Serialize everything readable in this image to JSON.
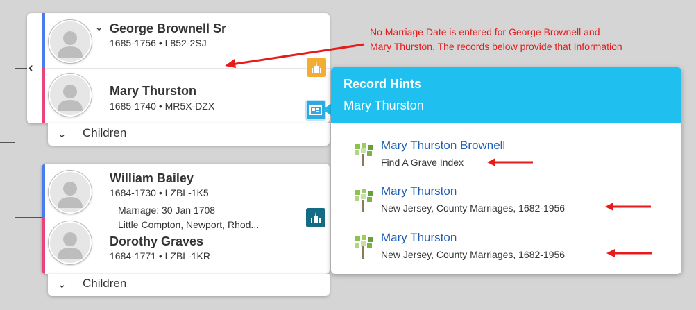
{
  "families": [
    {
      "father": {
        "name": "George Brownell Sr",
        "meta": "1685-1756 • L852-2SJ"
      },
      "mother": {
        "name": "Mary Thurston",
        "meta": "1685-1740 • MR5X-DZX"
      },
      "children_label": "Children"
    },
    {
      "father": {
        "name": "William Bailey",
        "meta": "1684-1730 • LZBL-1K5"
      },
      "marriage": {
        "date": "Marriage: 30 Jan 1708",
        "place": "Little Compton, Newport, Rhod..."
      },
      "mother": {
        "name": "Dorothy Graves",
        "meta": "1684-1771 • LZBL-1KR"
      },
      "children_label": "Children"
    }
  ],
  "annotation": {
    "line1": "No Marriage Date is entered for George Brownell and",
    "line2": "Mary Thurston. The records below provide that Information"
  },
  "record_hints": {
    "title": "Record Hints",
    "person": "Mary Thurston",
    "items": [
      {
        "name": "Mary Thurston Brownell",
        "source": "Find A Grave Index"
      },
      {
        "name": "Mary Thurston",
        "source": "New Jersey, County Marriages, 1682-1956"
      },
      {
        "name": "Mary Thurston",
        "source": "New Jersey, County Marriages, 1682-1956"
      }
    ]
  },
  "icons": {
    "expand": "chevron-down-icon",
    "back": "chevron-left-icon",
    "temple_pending": "temple-icon",
    "temple_done": "temple-icon",
    "record_hint": "record-hint-icon",
    "hint_tree": "tree-icon",
    "avatar": "person-silhouette-icon"
  },
  "colors": {
    "accent_blue": "#1fc0ef",
    "male_strip": "#4a7cf0",
    "female_strip": "#e8447a",
    "temple_orange": "#f5ac34",
    "temple_teal": "#136c84",
    "link_blue": "#1d5fb8",
    "annotation_red": "#e61b1b"
  }
}
